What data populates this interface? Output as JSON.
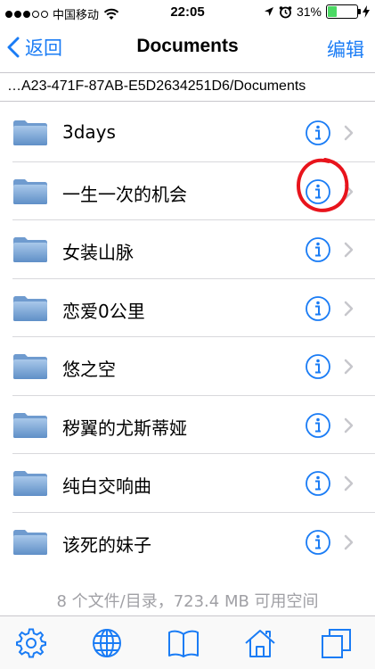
{
  "status_bar": {
    "carrier": "中国移动",
    "time": "22:05",
    "battery": "31%",
    "battery_level": 0.31,
    "signal_bars_filled": 3,
    "signal_bars_total": 5
  },
  "nav": {
    "back_label": "返回",
    "title": "Documents",
    "edit_label": "编辑"
  },
  "path": "…A23-471F-87AB-E5D2634251D6/Documents",
  "files": [
    {
      "name": "3days"
    },
    {
      "name": "一生一次的机会"
    },
    {
      "name": "女装山脉"
    },
    {
      "name": "恋爱0公里"
    },
    {
      "name": "悠之空"
    },
    {
      "name": "秽翼的尤斯蒂娅"
    },
    {
      "name": "纯白交响曲"
    },
    {
      "name": "该死的妹子"
    }
  ],
  "footer": "8 个文件/目录，723.4 MB 可用空间",
  "colors": {
    "accent": "#1a7cf5",
    "folder": "#7aa7d6",
    "annotation": "#e8141c",
    "battery": "#4cd964"
  },
  "tabs": [
    {
      "icon": "gear-icon"
    },
    {
      "icon": "globe-icon"
    },
    {
      "icon": "book-icon"
    },
    {
      "icon": "home-icon"
    },
    {
      "icon": "windows-icon"
    }
  ]
}
